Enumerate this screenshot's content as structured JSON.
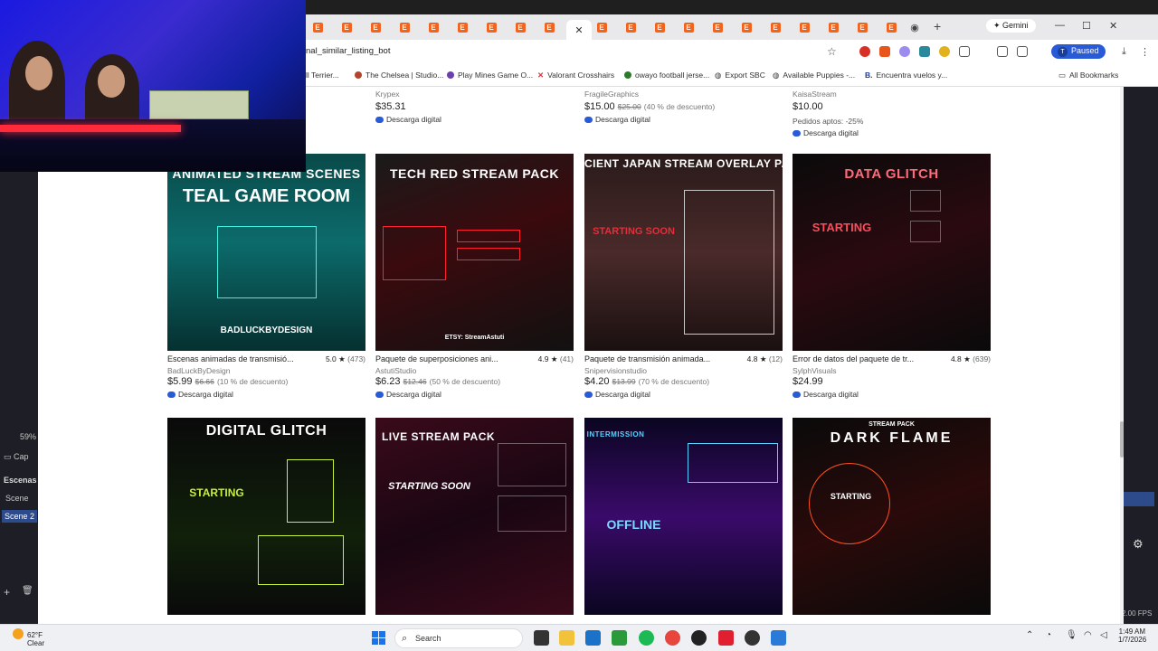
{
  "browser": {
    "url": "nal_similar_listing_bot",
    "gemini_label": "Gemini",
    "profile_initial": "T",
    "profile_status": "Paused",
    "tab_favicon_letter": "E",
    "bookmarks": [
      {
        "label": "ll Terrier...",
        "icon": "dot",
        "color": "#8a5a2b"
      },
      {
        "label": "The Chelsea | Studio...",
        "icon": "dot",
        "color": "#b0452b"
      },
      {
        "label": "Play Mines Game O...",
        "icon": "dot",
        "color": "#6a3fb0"
      },
      {
        "label": "Valorant Crosshairs",
        "icon": "x-mark",
        "color": "#e0323c"
      },
      {
        "label": "owayo football jerse...",
        "icon": "dot",
        "color": "#2a7b2a"
      },
      {
        "label": "Export SBC",
        "icon": "globe",
        "color": "#555555"
      },
      {
        "label": "Available Puppies -...",
        "icon": "globe",
        "color": "#555555"
      },
      {
        "label": "Encuentra vuelos y...",
        "icon": "b-badge",
        "color": "#1a3a9b"
      },
      {
        "label": "All Bookmarks",
        "icon": "folder",
        "color": "#555555"
      }
    ]
  },
  "top_row": [
    {
      "shop": "Krypex",
      "price": "$35.31",
      "original": "",
      "discount": "",
      "note": "",
      "download": "Descarga digital"
    },
    {
      "shop": "FragileGraphics",
      "price": "$15.00",
      "original": "$25.00",
      "discount": "(40 % de descuento)",
      "note": "",
      "download": "Descarga digital"
    },
    {
      "shop": "KaisaStream",
      "price": "$10.00",
      "original": "",
      "discount": "",
      "note": "Pedidos aptos: -25%",
      "download": "Descarga digital"
    }
  ],
  "products": [
    {
      "thumb_title": "ANIMATED STREAM SCENES",
      "thumb_title2": "TEAL GAME ROOM",
      "thumb_mid": "BADLUCKBYDESIGN",
      "name": "Escenas animadas de transmisió...",
      "rating": "5.0",
      "count": "(473)",
      "shop": "BadLuckByDesign",
      "price": "$5.99",
      "original": "$6.66",
      "discount": "(10 % de descuento)",
      "download": "Descarga digital"
    },
    {
      "thumb_title": "TECH RED STREAM PACK",
      "thumb_title2": "",
      "thumb_mid": "ETSY: StreamAstuti",
      "name": "Paquete de superposiciones ani...",
      "rating": "4.9",
      "count": "(41)",
      "shop": "AstutiStudio",
      "price": "$6.23",
      "original": "$12.46",
      "discount": "(50 % de descuento)",
      "download": "Descarga digital"
    },
    {
      "thumb_title": "CIENT JAPAN STREAM OVERLAY PA",
      "thumb_title2": "",
      "thumb_mid": "STARTING SOON",
      "name": "Paquete de transmisión animada...",
      "rating": "4.8",
      "count": "(12)",
      "shop": "Snipervisionstudio",
      "price": "$4.20",
      "original": "$13.99",
      "discount": "(70 % de descuento)",
      "download": "Descarga digital"
    },
    {
      "thumb_title": "DATA GLITCH",
      "thumb_title2": "",
      "thumb_mid": "STARTING",
      "name": "Error de datos del paquete de tr...",
      "rating": "4.8",
      "count": "(639)",
      "shop": "SylphVisuals",
      "price": "$24.99",
      "original": "",
      "discount": "",
      "download": "Descarga digital"
    },
    {
      "thumb_title": "DIGITAL GLITCH",
      "thumb_title2": "",
      "thumb_mid": "STARTING"
    },
    {
      "thumb_title": "LIVE STREAM PACK",
      "thumb_title2": "",
      "thumb_mid": "STARTING SOON"
    },
    {
      "thumb_title": "INTERMISSION",
      "thumb_title2": "",
      "thumb_mid": "OFFLINE"
    },
    {
      "thumb_title": "DARK FLAME",
      "thumb_title2": "STREAM PACK",
      "thumb_mid": "STARTING"
    }
  ],
  "obs": {
    "percent": "59%",
    "capture": "Cap",
    "scenes_header": "Escenas",
    "scene1": "Scene",
    "scene2": "Scene 2",
    "fps": "2.00 FPS"
  },
  "taskbar": {
    "temp": "62°F",
    "condition": "Clear",
    "search": "Search",
    "time": "1:49 AM",
    "date": "1/7/2026"
  }
}
